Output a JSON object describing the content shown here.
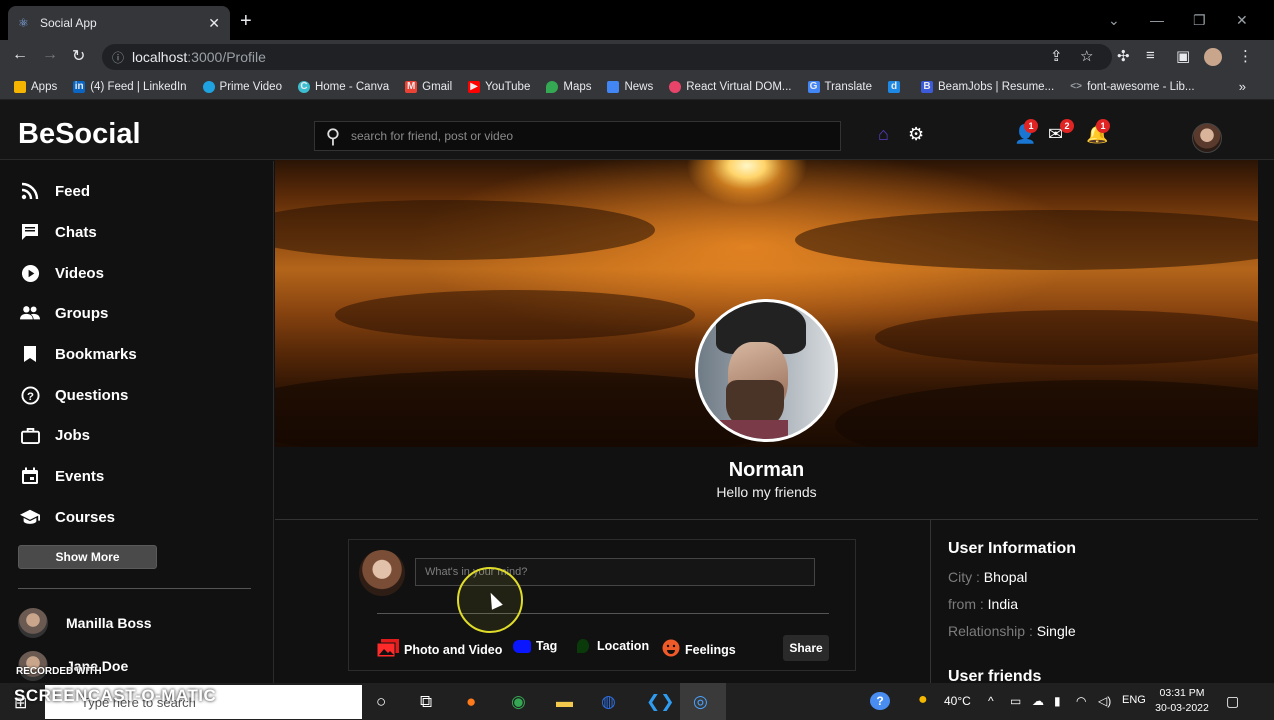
{
  "browser": {
    "tab_title": "Social App",
    "url_host": "localhost",
    "url_path": ":3000/Profile",
    "bookmarks": [
      {
        "label": "Apps",
        "color": "#f4b400"
      },
      {
        "label": "(4) Feed | LinkedIn",
        "color": "#0a66c2"
      },
      {
        "label": "Prime Video",
        "color": "#1fa3e0"
      },
      {
        "label": "Home - Canva",
        "color": "#3bbfd0"
      },
      {
        "label": "Gmail",
        "color": "#ea4335"
      },
      {
        "label": "YouTube",
        "color": "#ff0000"
      },
      {
        "label": "Maps",
        "color": "#34a853"
      },
      {
        "label": "News",
        "color": "#4285f4"
      },
      {
        "label": "React Virtual DOM...",
        "color": "#e8446a"
      },
      {
        "label": "Translate",
        "color": "#4285f4"
      },
      {
        "label": "",
        "color": "#1e88e5"
      },
      {
        "label": "BeamJobs | Resume...",
        "color": "#3b5bdb"
      },
      {
        "label": "font-awesome - Lib...",
        "color": "#9aa0a6"
      }
    ]
  },
  "app": {
    "logo": "BeSocial",
    "search_placeholder": "search for friend, post or video",
    "badges": {
      "friends": "1",
      "messages": "2",
      "notifications": "1"
    }
  },
  "sidebar": {
    "items": [
      {
        "label": "Feed",
        "icon": "rss-icon"
      },
      {
        "label": "Chats",
        "icon": "chat-icon"
      },
      {
        "label": "Videos",
        "icon": "play-circle-icon"
      },
      {
        "label": "Groups",
        "icon": "group-icon"
      },
      {
        "label": "Bookmarks",
        "icon": "bookmark-icon"
      },
      {
        "label": "Questions",
        "icon": "help-circle-icon"
      },
      {
        "label": "Jobs",
        "icon": "briefcase-icon"
      },
      {
        "label": "Events",
        "icon": "calendar-icon"
      },
      {
        "label": "Courses",
        "icon": "school-icon"
      }
    ],
    "show_more": "Show More",
    "friends": [
      "Manilla Boss",
      "Jane Doe"
    ]
  },
  "profile": {
    "name": "Norman",
    "description": "Hello my friends"
  },
  "share": {
    "placeholder": "What's in your mind?",
    "options": [
      "Photo and Video",
      "Tag",
      "Location",
      "Feelings"
    ],
    "button": "Share"
  },
  "user_info": {
    "title": "User Information",
    "rows": [
      {
        "key": "City : ",
        "value": "Bhopal"
      },
      {
        "key": "from : ",
        "value": "India"
      },
      {
        "key": "Relationship : ",
        "value": "Single"
      }
    ],
    "friends_title": "User friends"
  },
  "watermark": {
    "small": "RECORDED WITH",
    "big": "SCREENCAST-O-MATIC"
  },
  "taskbar": {
    "search_placeholder": "Type here to search",
    "temperature": "40°C",
    "language": "ENG",
    "time": "03:31 PM",
    "date": "30-03-2022"
  }
}
